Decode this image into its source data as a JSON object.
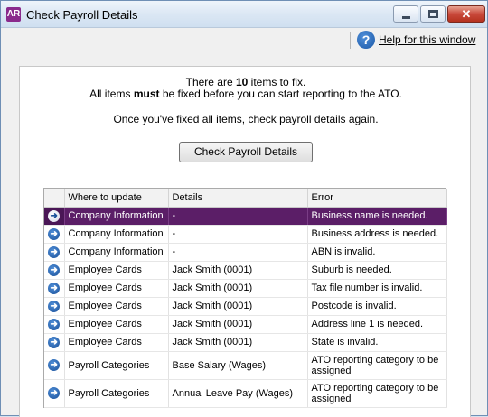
{
  "window": {
    "logo": "AR",
    "title": "Check Payroll Details",
    "controls": {
      "minimize": "minimize-icon",
      "maximize": "maximize-icon",
      "close": "close-icon"
    }
  },
  "help": {
    "icon": "help-icon",
    "icon_glyph": "?",
    "label": "Help for this window"
  },
  "message": {
    "line1_pre": "There are ",
    "count": "10",
    "line1_post": " items to fix.",
    "line2_pre": "All items ",
    "line2_bold": "must",
    "line2_post": " be fixed before you can start reporting to the ATO.",
    "line3": "Once you've fixed all items, check payroll details again."
  },
  "check_button": {
    "label": "Check Payroll Details"
  },
  "table": {
    "columns": [
      "",
      "Where to update",
      "Details",
      "Error"
    ],
    "rows": [
      {
        "where": "Company Information",
        "details": "-",
        "error": "Business name is needed."
      },
      {
        "where": "Company Information",
        "details": "-",
        "error": "Business address is needed."
      },
      {
        "where": "Company Information",
        "details": "-",
        "error": "ABN is invalid."
      },
      {
        "where": "Employee Cards",
        "details": "Jack Smith (0001)",
        "error": "Suburb is needed."
      },
      {
        "where": "Employee Cards",
        "details": "Jack Smith (0001)",
        "error": "Tax file number is invalid."
      },
      {
        "where": "Employee Cards",
        "details": "Jack Smith (0001)",
        "error": "Postcode is invalid."
      },
      {
        "where": "Employee Cards",
        "details": "Jack Smith (0001)",
        "error": "Address line 1 is needed."
      },
      {
        "where": "Employee Cards",
        "details": "Jack Smith (0001)",
        "error": "State is invalid."
      },
      {
        "where": "Payroll Categories",
        "details": "Base Salary (Wages)",
        "error": "ATO reporting category to be assigned"
      },
      {
        "where": "Payroll Categories",
        "details": "Annual Leave Pay (Wages)",
        "error": "ATO reporting category to be assigned"
      }
    ],
    "selected_row": 0,
    "row_icon": "arrow-right-icon"
  },
  "colors": {
    "selection": "#5b1e67",
    "accent": "#1d5aa8",
    "logo": "#8a2a8c"
  }
}
